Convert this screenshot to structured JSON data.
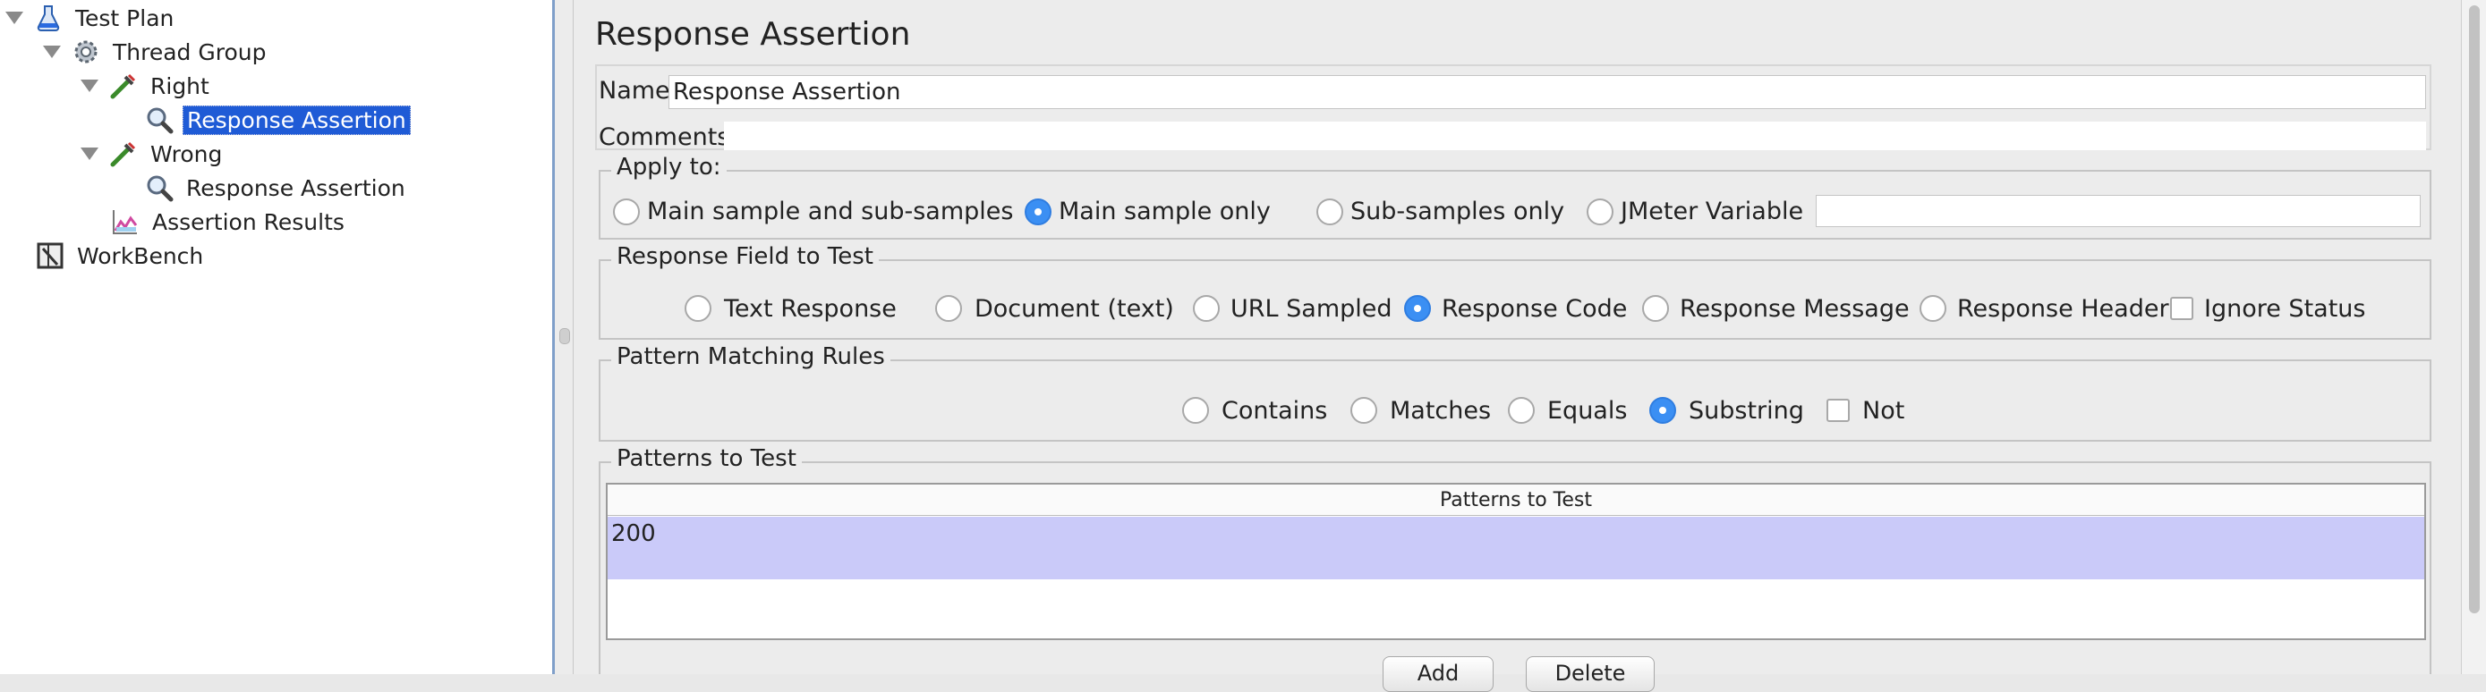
{
  "tree": {
    "items": [
      {
        "label": "Test Plan",
        "icon": "flask-icon",
        "expanded": true
      },
      {
        "label": "Thread Group",
        "icon": "gear-icon",
        "expanded": true
      },
      {
        "label": "Right",
        "icon": "sampler-icon",
        "expanded": true
      },
      {
        "label": "Response Assertion",
        "icon": "magnifier-icon",
        "selected": true
      },
      {
        "label": "Wrong",
        "icon": "sampler-icon",
        "expanded": true
      },
      {
        "label": "Response Assertion",
        "icon": "magnifier-icon"
      },
      {
        "label": "Assertion Results",
        "icon": "graph-icon"
      },
      {
        "label": "WorkBench",
        "icon": "workbench-icon"
      }
    ]
  },
  "panel": {
    "title": "Response Assertion",
    "name_label": "Name:",
    "name_value": "Response Assertion",
    "comments_label": "Comments:",
    "comments_value": ""
  },
  "apply_to": {
    "legend": "Apply to:",
    "options": [
      "Main sample and sub-samples",
      "Main sample only",
      "Sub-samples only",
      "JMeter Variable"
    ],
    "selected": "Main sample only",
    "variable_value": ""
  },
  "response_field": {
    "legend": "Response Field to Test",
    "options": [
      "Text Response",
      "Document (text)",
      "URL Sampled",
      "Response Code",
      "Response Message",
      "Response Headers"
    ],
    "selected": "Response Code",
    "checkbox_label": "Ignore Status",
    "checkbox_checked": false
  },
  "pattern_rules": {
    "legend": "Pattern Matching Rules",
    "options": [
      "Contains",
      "Matches",
      "Equals",
      "Substring"
    ],
    "selected": "Substring",
    "not_label": "Not",
    "not_checked": false
  },
  "patterns": {
    "legend": "Patterns to Test",
    "column_header": "Patterns to Test",
    "rows": [
      "200"
    ],
    "add_label": "Add",
    "delete_label": "Delete"
  },
  "colors": {
    "selection": "#1f5bd6",
    "radio_selected": "#3b8ff3",
    "table_row": "#cacaf9"
  }
}
